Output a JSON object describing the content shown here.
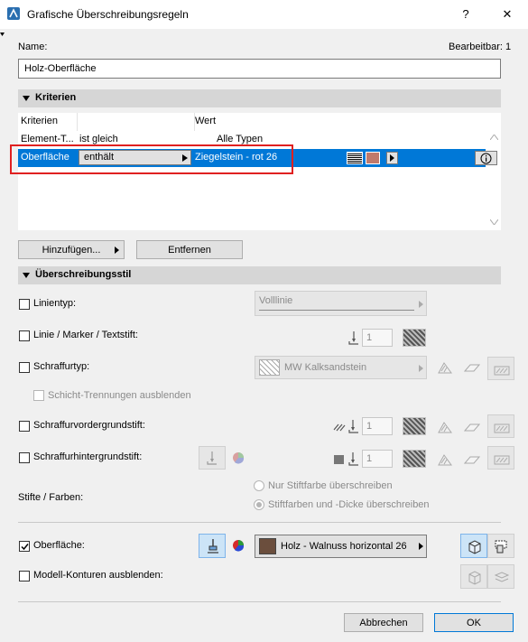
{
  "window": {
    "title": "Grafische Überschreibungsregeln",
    "help_label": "?",
    "close_label": "✕"
  },
  "header": {
    "name_label": "Name:",
    "editable_label": "Bearbeitbar: 1",
    "name_value": "Holz-Oberfläche"
  },
  "criteria": {
    "section_title": "Kriterien",
    "columns": [
      "Kriterien",
      "",
      "Wert"
    ],
    "rows": [
      {
        "criterion": "Element-T...",
        "operator": "ist gleich",
        "value": "Alle Typen"
      },
      {
        "criterion": "Oberfläche",
        "operator": "enthält",
        "value": "Ziegelstein - rot 26"
      }
    ],
    "add_button": "Hinzufügen...",
    "remove_button": "Entfernen",
    "swatch_color": "#c07a6c",
    "highlight_color": "#0078d7",
    "info_icon": "info-icon"
  },
  "style": {
    "section_title": "Überschreibungsstil",
    "linetype": {
      "label": "Linientyp:",
      "value": "Volllinie",
      "checked": false
    },
    "line_pen": {
      "label": "Linie / Marker / Textstift:",
      "value": "1",
      "checked": false
    },
    "fill_type": {
      "label": "Schraffurtyp:",
      "value": "MW Kalksandstein",
      "checked": false
    },
    "hide_layers": {
      "label": "Schicht-Trennungen ausblenden",
      "checked": false
    },
    "fg_pen": {
      "label": "Schraffurvordergrundstift:",
      "value": "1",
      "checked": false
    },
    "bg_pen": {
      "label": "Schraffurhintergrundstift:",
      "value": "1",
      "checked": false
    },
    "pens_colors": {
      "label": "Stifte / Farben:",
      "option1": "Nur Stiftfarbe überschreiben",
      "option2": "Stiftfarben und -Dicke überschreiben"
    },
    "surface": {
      "label": "Oberfläche:",
      "value": "Holz - Walnuss horizontal 26",
      "checked": true,
      "swatch_color": "#6b4e3d"
    },
    "hide_contours": {
      "label": "Modell-Konturen ausblenden:",
      "checked": false
    }
  },
  "footer": {
    "cancel_button": "Abbrechen",
    "ok_button": "OK"
  }
}
